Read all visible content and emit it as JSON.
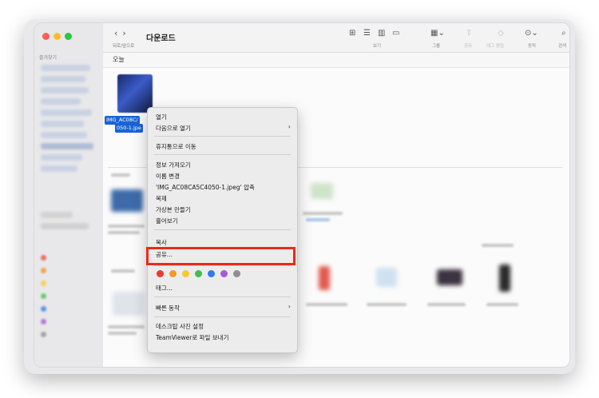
{
  "window": {
    "title": "다운로드",
    "nav_back": "‹",
    "nav_forward": "›",
    "nav_sub": "뒤로/앞으로",
    "section_today": "오늘"
  },
  "sidebar": {
    "favorites_label": "즐겨찾기"
  },
  "toolbar": {
    "view_label": "보기",
    "group_label": "그룹",
    "share_label": "공유",
    "tag_edit_label": "태그 편집",
    "action_label": "동작",
    "search_label": "검색"
  },
  "file": {
    "name_line1": "IMG_AC08C/",
    "name_line2": "050-1.jpe"
  },
  "menu": {
    "open": "열기",
    "open_with": "다음으로 열기",
    "trash": "휴지통으로 이동",
    "get_info": "정보 가져오기",
    "rename": "이름 변경",
    "compress": "'IMG_AC08CA5C4050-1.jpeg' 압축",
    "duplicate": "복제",
    "make_alias": "가상본 만들기",
    "quick_look": "훑어보기",
    "copy": "복사",
    "share": "공유...",
    "tags": "태그...",
    "quick_actions": "빠른 동작",
    "set_desktop": "데스크탑 사진 설정",
    "teamviewer": "TeamViewer로 파일 보내기"
  },
  "tag_colors": [
    "#ec3b2e",
    "#f39a2a",
    "#f5c92e",
    "#3cc04a",
    "#2f7bf0",
    "#a65bd6",
    "#8e8e93"
  ],
  "highlight_color": "#ec2a17"
}
